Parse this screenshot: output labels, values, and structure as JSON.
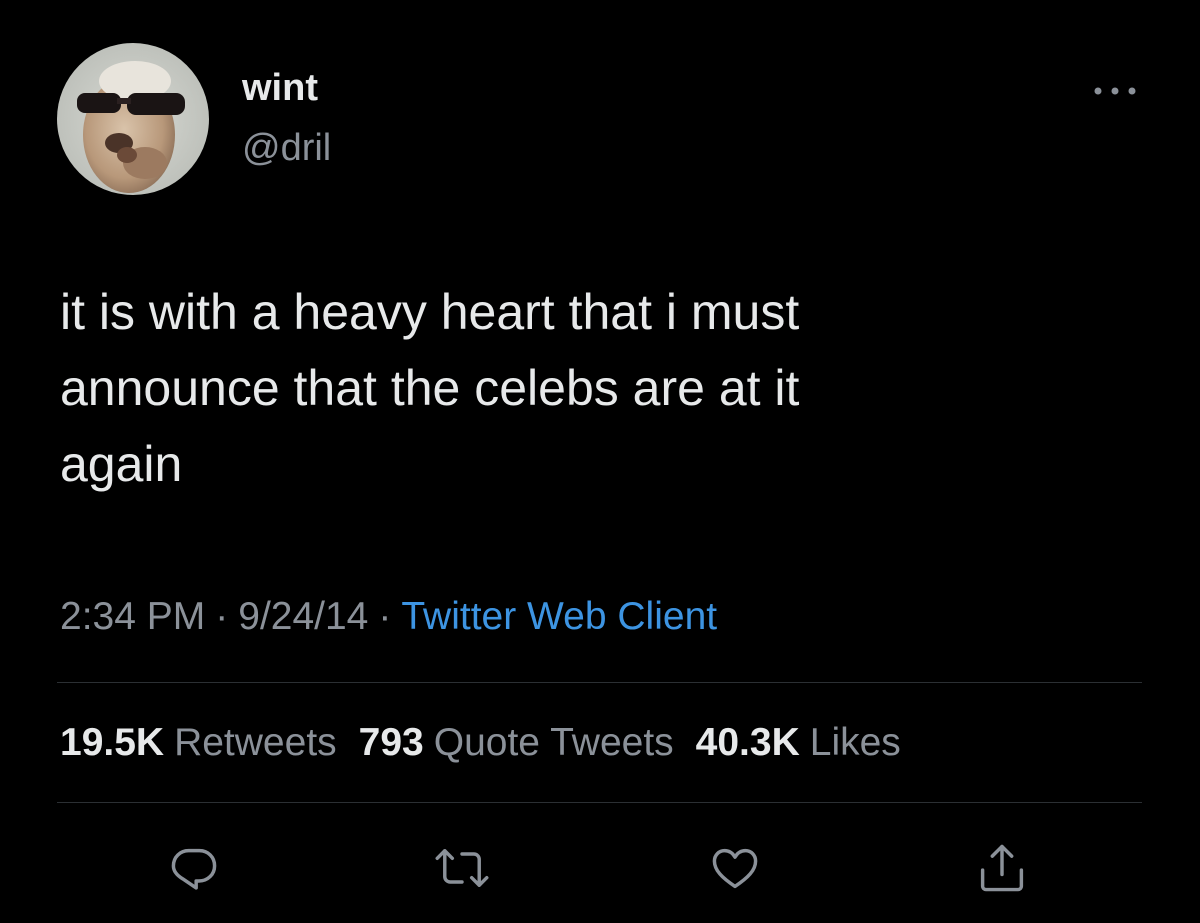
{
  "author": {
    "display_name": "wint",
    "handle": "@dril"
  },
  "tweet": {
    "text": "it is with a heavy heart that i must\nannounce that the celebs are at it\nagain"
  },
  "meta": {
    "time": "2:34 PM",
    "separator": "·",
    "date": "9/24/14",
    "client": "Twitter Web Client"
  },
  "stats": {
    "retweets_count": "19.5K",
    "retweets_label": "Retweets",
    "quotes_count": "793",
    "quotes_label": "Quote Tweets",
    "likes_count": "40.3K",
    "likes_label": "Likes"
  },
  "icons": {
    "more": "more-horizontal-icon",
    "reply": "reply-icon",
    "retweet": "retweet-icon",
    "like": "heart-icon",
    "share": "share-icon"
  },
  "colors": {
    "background": "#000000",
    "text": "#e7e9ea",
    "secondary": "#8b9199",
    "link": "#3d94e2",
    "divider": "#2b2f33"
  }
}
